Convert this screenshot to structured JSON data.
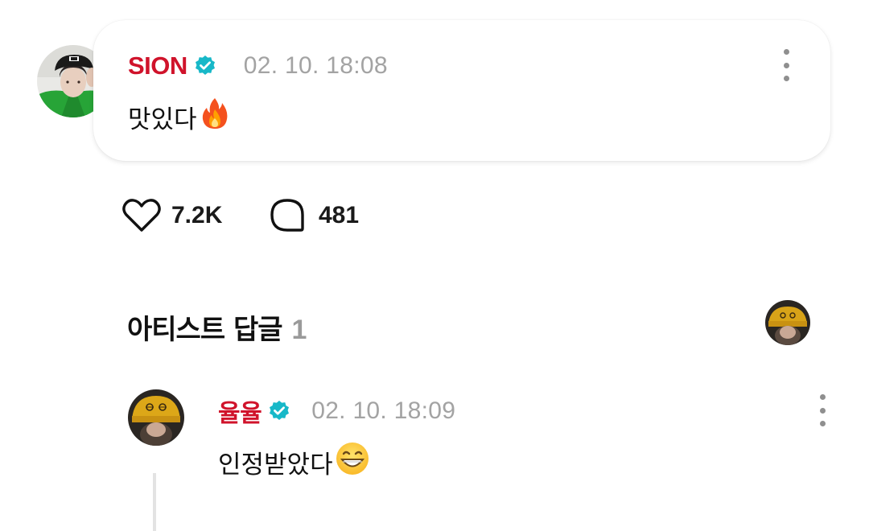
{
  "post": {
    "author": "SION",
    "timestamp": "02. 10. 18:08",
    "text": "맛있다",
    "emoji": "fire-emoji"
  },
  "actions": {
    "likes": "7.2K",
    "comments": "481"
  },
  "replies_section": {
    "title": "아티스트 답글",
    "count": "1"
  },
  "reply": {
    "author": "율율",
    "timestamp": "02. 10. 18:09",
    "text": "인정받았다",
    "emoji": "grinning-emoji"
  },
  "colors": {
    "author_red": "#d0132b",
    "verified_teal": "#17b8c8",
    "muted_gray": "#a3a3a3"
  }
}
